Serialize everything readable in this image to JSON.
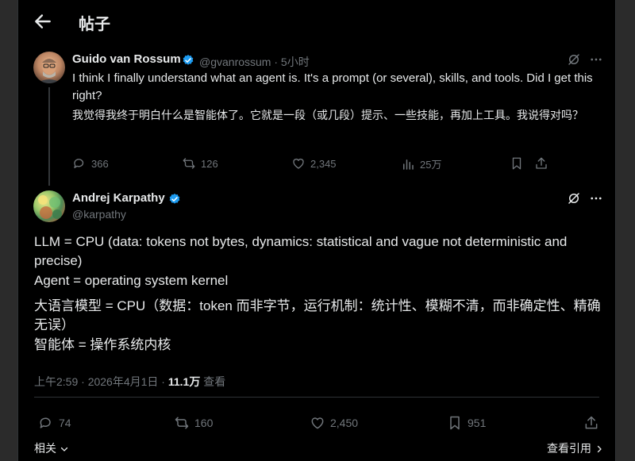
{
  "header": {
    "title": "帖子"
  },
  "parent_post": {
    "author_name": "Guido van Rossum",
    "handle": "@gvanrossum",
    "time": "5小时",
    "text_en": "I think I finally understand what an agent is. It's a prompt (or several), skills, and tools. Did I get this right?",
    "text_zh": "我觉得我终于明白什么是智能体了。它就是一段（或几段）提示、一些技能，再加上工具。我说得对吗？",
    "replies": "366",
    "reposts": "126",
    "likes": "2,345",
    "views": "25万"
  },
  "main_post": {
    "author_name": "Andrej Karpathy",
    "handle": "@karpathy",
    "line1": "LLM = CPU (data: tokens not bytes, dynamics: statistical and vague not deterministic and precise)",
    "line2": "Agent = operating system kernel",
    "line3": "大语言模型 = CPU（数据：token 而非字节，运行机制：统计性、模糊不清，而非确定性、精确无误）",
    "line4": "智能体 = 操作系统内核",
    "timestamp": "上午2:59 · 2026年4月1日 ·",
    "views": "11.1万",
    "views_label": "查看",
    "replies": "74",
    "reposts": "160",
    "likes": "2,450",
    "bookmarks": "951"
  },
  "footer": {
    "related": "相关",
    "quotes": "查看引用"
  },
  "colors": {
    "background": "#000000",
    "text": "#e7e9ea",
    "muted": "#71767b",
    "verified": "#1d9bf0",
    "divider": "#2f3336"
  },
  "icons": [
    "back-arrow-icon",
    "verified-badge-icon",
    "translate-icon",
    "more-icon",
    "reply-icon",
    "repost-icon",
    "like-icon",
    "views-icon",
    "bookmark-icon",
    "share-icon",
    "chevron-down-icon",
    "chevron-right-icon"
  ]
}
